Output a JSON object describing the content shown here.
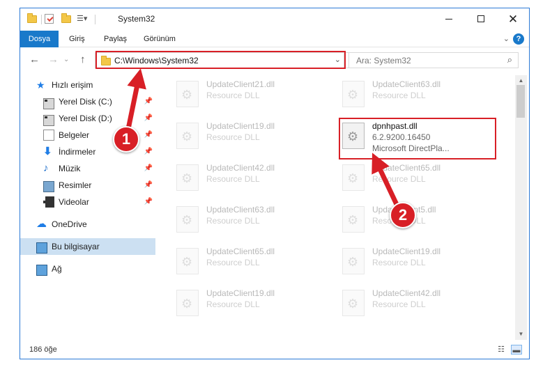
{
  "window": {
    "title": "System32"
  },
  "ribbon": {
    "tabs": [
      "Dosya",
      "Giriş",
      "Paylaş",
      "Görünüm"
    ],
    "help": "?"
  },
  "address": {
    "path": "C:\\Windows\\System32"
  },
  "search": {
    "placeholder": "Ara: System32"
  },
  "sidebar": {
    "quick_access": "Hızlı erişim",
    "items": [
      {
        "label": "Yerel Disk (C:)",
        "icon": "disk-icon"
      },
      {
        "label": "Yerel Disk (D:)",
        "icon": "disk-icon"
      },
      {
        "label": "Belgeler",
        "icon": "documents-icon"
      },
      {
        "label": "İndirmeler",
        "icon": "downloads-icon"
      },
      {
        "label": "Müzik",
        "icon": "music-icon"
      },
      {
        "label": "Resimler",
        "icon": "pictures-icon"
      },
      {
        "label": "Videolar",
        "icon": "videos-icon"
      }
    ],
    "onedrive": "OneDrive",
    "this_pc": "Bu bilgisayar",
    "network": "Ağ"
  },
  "files": {
    "left": [
      {
        "name": "UpdateClient21.dll",
        "type": "Resource DLL"
      },
      {
        "name": "UpdateClient19.dll",
        "type": "Resource DLL"
      },
      {
        "name": "UpdateClient42.dll",
        "type": "Resource DLL"
      },
      {
        "name": "UpdateClient63.dll",
        "type": "Resource DLL"
      },
      {
        "name": "UpdateClient65.dll",
        "type": "Resource DLL"
      },
      {
        "name": "UpdateClient19.dll",
        "type": "Resource DLL"
      }
    ],
    "right": [
      {
        "name": "UpdateClient63.dll",
        "type": "Resource DLL"
      },
      {
        "name": "UpdateClient65.dll",
        "type": "Resource DLL"
      },
      {
        "name": "UpdateClient5.dll",
        "type": "Resource DLL"
      },
      {
        "name": "UpdateClient19.dll",
        "type": "Resource DLL"
      },
      {
        "name": "UpdateClient42.dll",
        "type": "Resource DLL"
      }
    ],
    "highlighted": {
      "name": "dpnhpast.dll",
      "version": "6.2.9200.16450",
      "description": "Microsoft DirectPla..."
    }
  },
  "status": {
    "count": "186 öğe"
  },
  "callouts": [
    "1",
    "2"
  ],
  "colors": {
    "accent": "#1979ca",
    "highlight": "#d81f26",
    "selected": "#cce0f2"
  }
}
